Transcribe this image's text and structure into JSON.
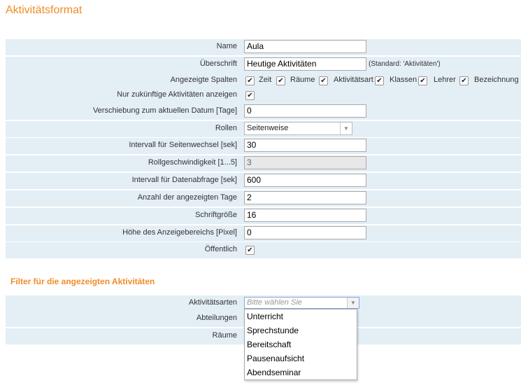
{
  "page_title": "Aktivitätsformat",
  "form": {
    "name": {
      "label": "Name",
      "value": "Aula"
    },
    "heading": {
      "label": "Überschrift",
      "value": "Heutige Aktivitäten",
      "hint": "(Standard: 'Aktivitäten')"
    },
    "columns": {
      "label": "Angezeigte Spalten",
      "items": [
        {
          "label": "Zeit",
          "checked": true
        },
        {
          "label": "Räume",
          "checked": true
        },
        {
          "label": "Aktivitätsart",
          "checked": true
        },
        {
          "label": "Klassen",
          "checked": true
        },
        {
          "label": "Lehrer",
          "checked": true
        },
        {
          "label": "Bezeichnung",
          "checked": true
        }
      ]
    },
    "future_only": {
      "label": "Nur zukünftige Aktivitäten anzeigen",
      "checked": true
    },
    "offset": {
      "label": "Verschiebung zum aktuellen Datum [Tage]",
      "value": "0"
    },
    "scroll": {
      "label": "Rollen",
      "value": "Seitenweise"
    },
    "page_interval": {
      "label": "Intervall für Seitenwechsel [sek]",
      "value": "30"
    },
    "scroll_speed": {
      "label": "Rollgeschwindigkeit [1...5]",
      "value": "3"
    },
    "fetch_interval": {
      "label": "Intervall für Datenabfrage [sek]",
      "value": "600"
    },
    "days": {
      "label": "Anzahl der angezeigten Tage",
      "value": "2"
    },
    "font_size": {
      "label": "Schriftgröße",
      "value": "16"
    },
    "display_height": {
      "label": "Höhe des Anzeigebereichs [Pixel]",
      "value": "0"
    },
    "public": {
      "label": "Öffentlich",
      "checked": true
    }
  },
  "filter": {
    "title": "Filter für die angezeigten Aktivitäten",
    "activity_types": {
      "label": "Aktivitätsarten",
      "placeholder": "Bitte wählen Sie"
    },
    "departments": {
      "label": "Abteilungen"
    },
    "rooms": {
      "label": "Räume"
    },
    "dropdown_options": [
      "Unterricht",
      "Sprechstunde",
      "Bereitschaft",
      "Pausenaufsicht",
      "Abendseminar"
    ]
  },
  "icons": {
    "check": "checkmark-icon",
    "arrow": "chevron-down-icon"
  },
  "colors": {
    "accent": "#f08c28",
    "row_bg": "#e4eef5"
  }
}
